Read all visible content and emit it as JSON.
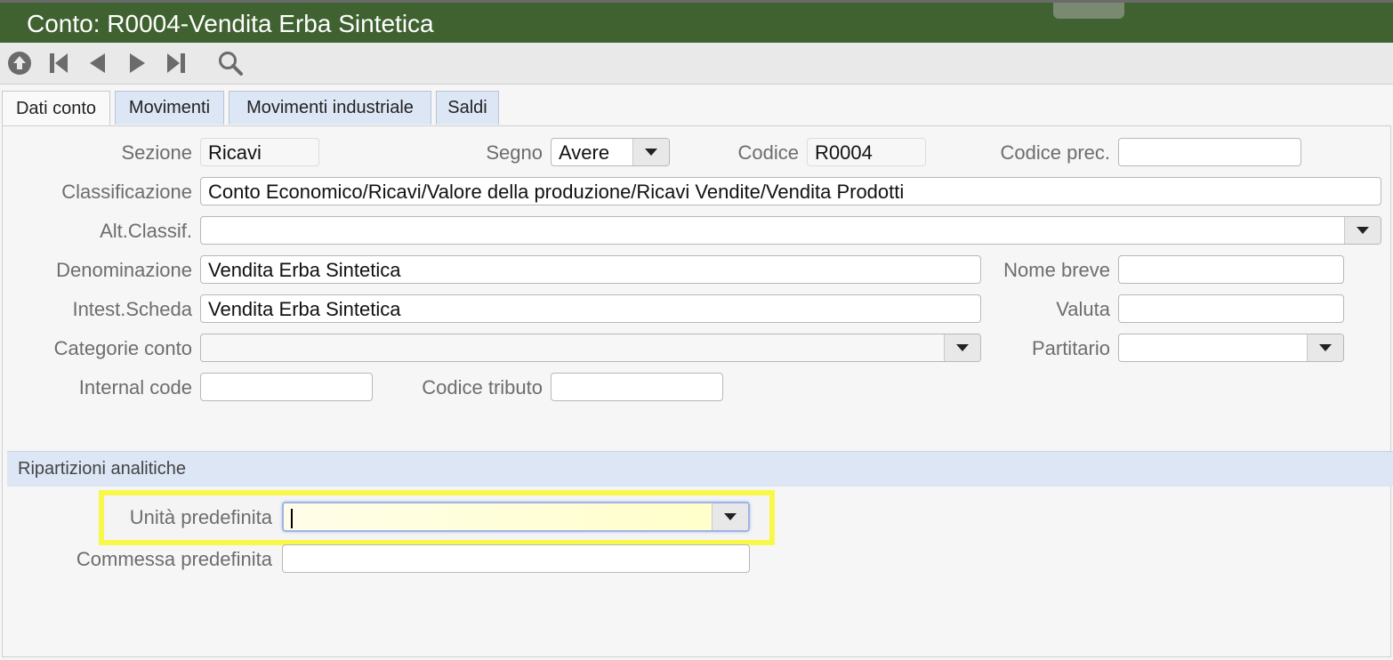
{
  "window": {
    "title": "Conto: R0004-Vendita Erba Sintetica"
  },
  "toolbar": {
    "icons": [
      "up-circle-icon",
      "first-record-icon",
      "previous-icon",
      "next-icon",
      "last-record-icon",
      "search-icon"
    ]
  },
  "tabs": [
    {
      "label": "Dati conto",
      "active": true
    },
    {
      "label": "Movimenti",
      "active": false
    },
    {
      "label": "Movimenti industriale",
      "active": false
    },
    {
      "label": "Saldi",
      "active": false
    }
  ],
  "form": {
    "sezione": {
      "label": "Sezione",
      "value": "Ricavi"
    },
    "segno": {
      "label": "Segno",
      "value": "Avere"
    },
    "codice": {
      "label": "Codice",
      "value": "R0004"
    },
    "codice_prec": {
      "label": "Codice prec.",
      "value": ""
    },
    "classificazione": {
      "label": "Classificazione",
      "value": "Conto Economico/Ricavi/Valore della produzione/Ricavi Vendite/Vendita Prodotti"
    },
    "alt_classif": {
      "label": "Alt.Classif.",
      "value": ""
    },
    "denominazione": {
      "label": "Denominazione",
      "value": "Vendita Erba Sintetica"
    },
    "nome_breve": {
      "label": "Nome breve",
      "value": ""
    },
    "intest_scheda": {
      "label": "Intest.Scheda",
      "value": "Vendita Erba Sintetica"
    },
    "valuta": {
      "label": "Valuta",
      "value": ""
    },
    "categorie_conto": {
      "label": "Categorie conto",
      "value": ""
    },
    "partitario": {
      "label": "Partitario",
      "value": ""
    },
    "internal_code": {
      "label": "Internal code",
      "value": ""
    },
    "codice_tributo": {
      "label": "Codice tributo",
      "value": ""
    }
  },
  "ripartizioni": {
    "title": "Ripartizioni analitiche",
    "unita_predefinita": {
      "label": "Unità predefinita",
      "value": ""
    },
    "commessa_predefinita": {
      "label": "Commessa predefinita",
      "value": ""
    }
  },
  "colors": {
    "titlebar": "#3f6230",
    "tab_inactive": "#dce6f5",
    "highlight": "#f8f84a"
  }
}
